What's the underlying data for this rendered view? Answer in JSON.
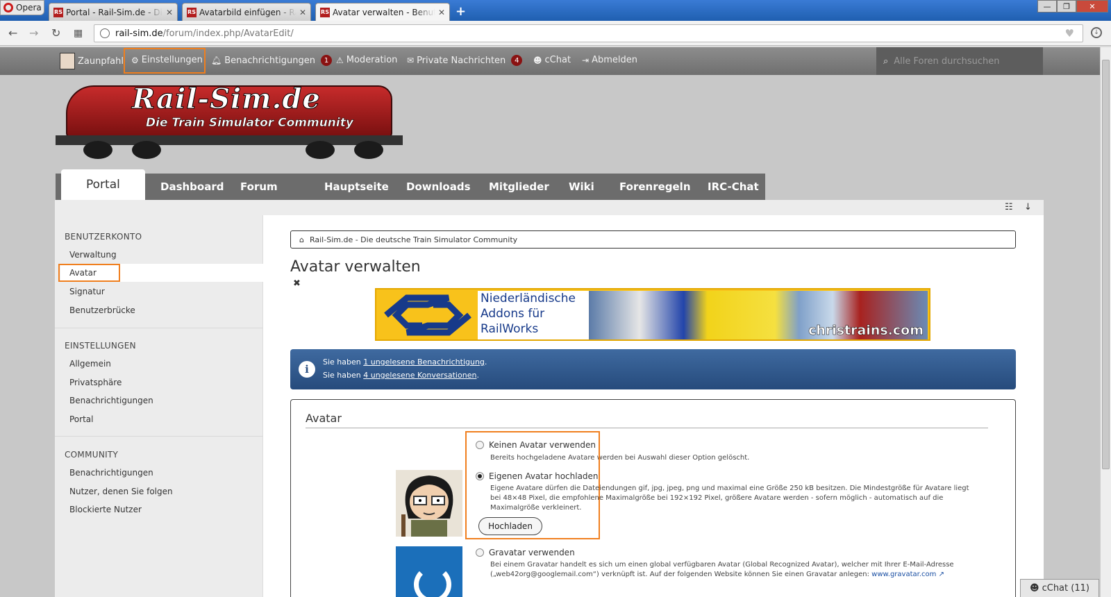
{
  "browser": {
    "menu_label": "Opera",
    "tabs": [
      {
        "label": "Portal - Rail-Sim.de - Die d",
        "favicon": "RS"
      },
      {
        "label": "Avatarbild einfügen - Rail-",
        "favicon": "RS"
      },
      {
        "label": "Avatar verwalten - Benutze",
        "favicon": "RS"
      }
    ],
    "new_tab": "+",
    "url_domain": "rail-sim.de",
    "url_path": "/forum/index.php/AvatarEdit/",
    "window_controls": [
      "—",
      "❐",
      "✕"
    ]
  },
  "userpanel": {
    "username": "Zaunpfahl",
    "items": [
      {
        "label": "Einstellungen",
        "icon": "gear-icon"
      },
      {
        "label": "Benachrichtigungen",
        "icon": "bell-icon",
        "badge": "1"
      },
      {
        "label": "Moderation",
        "icon": "warning-icon"
      },
      {
        "label": "Private Nachrichten",
        "icon": "chat-icon",
        "badge": "4"
      },
      {
        "label": "cChat",
        "icon": "users-icon"
      },
      {
        "label": "Abmelden",
        "icon": "logout-icon"
      }
    ],
    "search_placeholder": "Alle Foren durchsuchen",
    "highlight_color": "#f07f1e"
  },
  "logo": {
    "title": "Rail-Sim.de",
    "subtitle": "Die Train Simulator Community"
  },
  "nav": {
    "tabs": [
      "Portal",
      "Dashboard",
      "Forum",
      "Hauptseite",
      "Downloads",
      "Mitglieder",
      "Wiki",
      "Forenregeln",
      "IRC-Chat"
    ]
  },
  "sidebar": {
    "sections": [
      {
        "heading": "BENUTZERKONTO",
        "items": [
          "Verwaltung",
          "Avatar",
          "Signatur",
          "Benutzerbrücke"
        ]
      },
      {
        "heading": "EINSTELLUNGEN",
        "items": [
          "Allgemein",
          "Privatsphäre",
          "Benachrichtigungen",
          "Portal"
        ]
      },
      {
        "heading": "COMMUNITY",
        "items": [
          "Benachrichtigungen",
          "Nutzer, denen Sie folgen",
          "Blockierte Nutzer"
        ]
      }
    ],
    "active_item": "Avatar"
  },
  "main": {
    "breadcrumb": "Rail-Sim.de - Die deutsche Train Simulator Community",
    "title": "Avatar verwalten",
    "banner": {
      "text": "Niederländische Addons für RailWorks",
      "brand": "christrains.com"
    },
    "info": {
      "line1_prefix": "Sie haben ",
      "line1_link": "1 ungelesene Benachrichtigung",
      "line1_suffix": ".",
      "line2_prefix": "Sie haben ",
      "line2_link": "4 ungelesene Konversationen",
      "line2_suffix": "."
    },
    "avatar_section": {
      "title": "Avatar",
      "options": [
        {
          "label": "Keinen Avatar verwenden",
          "desc": "Bereits hochgeladene Avatare werden bei Auswahl dieser Option gelöscht.",
          "checked": false
        },
        {
          "label": "Eigenen Avatar hochladen",
          "desc": "Eigene Avatare dürfen die Dateiendungen gif, jpg, jpeg, png und maximal eine Größe 250 kB besitzen. Die Mindestgröße für Avatare liegt bei 48×48 Pixel, die empfohlene Maximalgröße bei 192×192 Pixel, größere Avatare werden - sofern möglich - automatisch auf die Maximalgröße verkleinert.",
          "checked": true
        },
        {
          "label": "Gravatar verwenden",
          "desc_prefix": "Bei einem Gravatar handelt es sich um einen global verfügbaren Avatar (Global Recognized Avatar), welcher mit Ihrer E-Mail-Adresse („web42org@googlemail.com“) verknüpft ist. Auf der folgenden Website können Sie einen Gravatar anlegen: ",
          "desc_link": "www.gravatar.com",
          "checked": false
        }
      ],
      "upload_button": "Hochladen"
    }
  },
  "cchat_label": "cChat (11)"
}
